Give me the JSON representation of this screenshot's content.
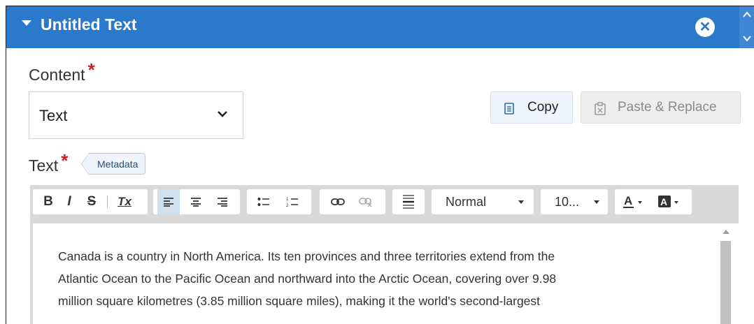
{
  "header": {
    "title": "Untitled Text"
  },
  "content_field": {
    "label": "Content",
    "required_mark": "*",
    "selected_value": "Text"
  },
  "actions": {
    "copy_label": "Copy",
    "paste_label": "Paste & Replace"
  },
  "text_field": {
    "label": "Text",
    "required_mark": "*",
    "metadata_tag": "Metadata"
  },
  "toolbar": {
    "bold": "B",
    "italic": "I",
    "strike": "S",
    "clear_format": "Tx",
    "format_dropdown": "Normal",
    "size_dropdown": "10..."
  },
  "body_lines": [
    "Canada is a country in North America. Its ten provinces and three territories extend from the",
    "Atlantic Ocean to the Pacific Ocean and northward into the Arctic Ocean, covering over 9.98",
    "million square kilometres (3.85 million square miles), making it the world's second-largest"
  ],
  "colors": {
    "header_bg": "#2b79cb",
    "required": "#d21f1f",
    "active_tool": "#cfe0ef"
  }
}
